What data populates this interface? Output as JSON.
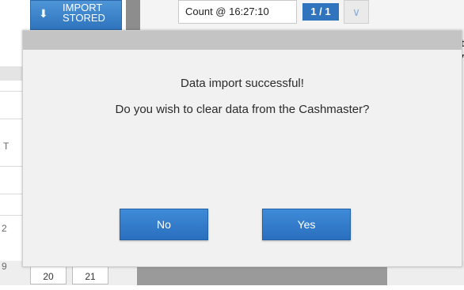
{
  "toolbar": {
    "import_label_line1": "IMPORT",
    "import_label_line2": "STORED",
    "count_label": "Count @ 16:27:10",
    "page_indicator": "1 / 1",
    "dropdown_icon": "chevron-down-icon",
    "import_icon": "download-icon"
  },
  "background": {
    "right_text_1": "it",
    "right_text_2": "ay",
    "left_letter": "T",
    "left_digit": "2",
    "left_digit_2": "9",
    "number_boxes": [
      "20",
      "21"
    ]
  },
  "dialog": {
    "message_1": "Data import successful!",
    "message_2": "Do you wish to clear data from the Cashmaster?",
    "no_label": "No",
    "yes_label": "Yes"
  },
  "colors": {
    "accent": "#2f74bd",
    "dialog_bg": "#f1f1f1",
    "dialog_header": "#c4c4c4"
  }
}
